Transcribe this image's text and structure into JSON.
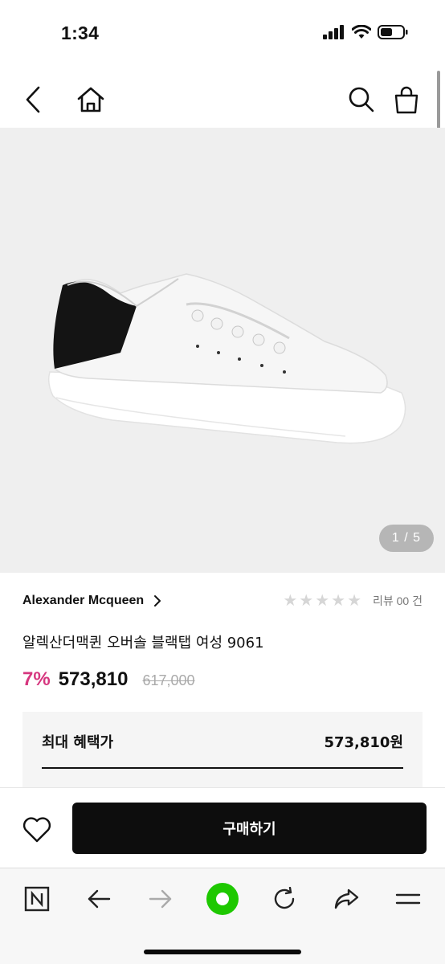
{
  "status": {
    "time": "1:34"
  },
  "header": {
    "back_icon": "chevron-left-icon",
    "home_icon": "home-icon",
    "search_icon": "search-icon",
    "cart_icon": "shopping-bag-icon"
  },
  "gallery": {
    "counter": "1 / 5"
  },
  "product": {
    "brand": "Alexander Mcqueen",
    "rating_stars": 0,
    "review_count_text": "리뷰 00 건",
    "title": "알렉산더맥퀸 오버솔 블랙탭 여성 9061",
    "discount": "7%",
    "price": "573,810",
    "original_price": "617,000"
  },
  "benefit": {
    "label": "최대 혜택가",
    "value": "573,810원"
  },
  "purchase": {
    "buy_label": "구매하기",
    "wishlist_icon": "heart-icon"
  },
  "browser": {
    "icons": [
      "naver-n-icon",
      "back-arrow-icon",
      "forward-arrow-icon",
      "green-dot-icon",
      "reload-icon",
      "share-icon",
      "menu-icon"
    ],
    "accent": "#1ec800"
  }
}
